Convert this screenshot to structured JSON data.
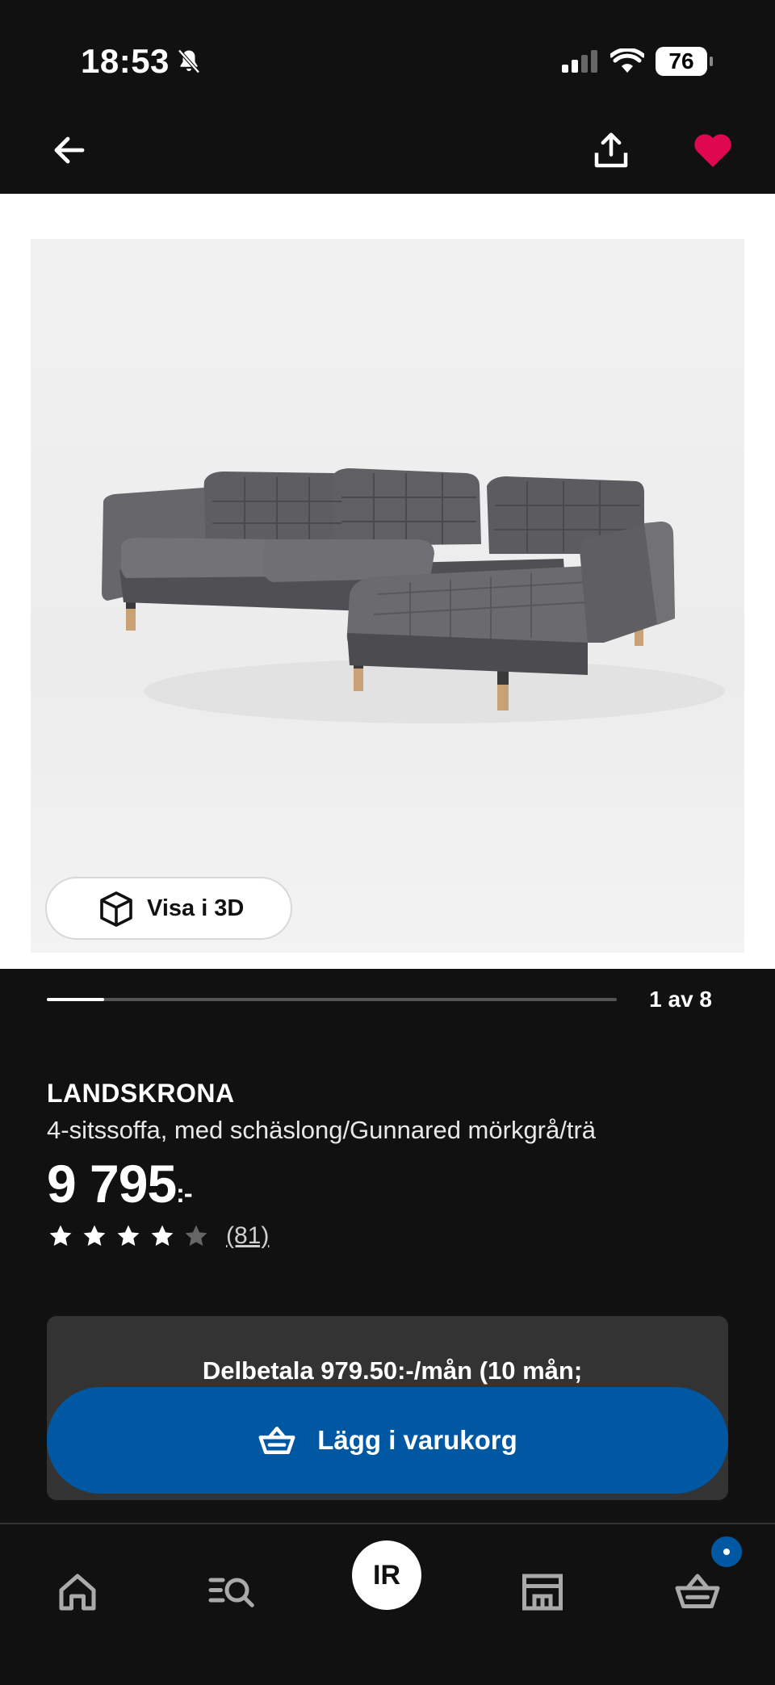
{
  "status_bar": {
    "time": "18:53",
    "battery": "76"
  },
  "header": {
    "back_icon": "arrow-left-icon",
    "share_icon": "share-icon",
    "favorite_icon": "heart-icon",
    "favorite_color": "#e00751"
  },
  "gallery": {
    "view_3d_label": "Visa i 3D",
    "counter": "1 av 8",
    "progress": 0.1
  },
  "product": {
    "name": "LANDSKRONA",
    "description": "4-sitssoffa, med schäslong/Gunnared mörkgrå/trä",
    "price_main": "9 795",
    "price_suffix": ":-",
    "rating": 4,
    "rating_max": 5,
    "review_count": "(81)"
  },
  "purchase": {
    "installment_text": "Delbetala 979.50:-/mån (10 mån;",
    "add_to_cart_label": "Lägg i varukorg",
    "accent_color": "#0058a3"
  },
  "bottom_nav": {
    "avatar_initials": "IR",
    "items": [
      "home-icon",
      "search-list-icon",
      "avatar",
      "store-icon",
      "cart-icon"
    ]
  }
}
